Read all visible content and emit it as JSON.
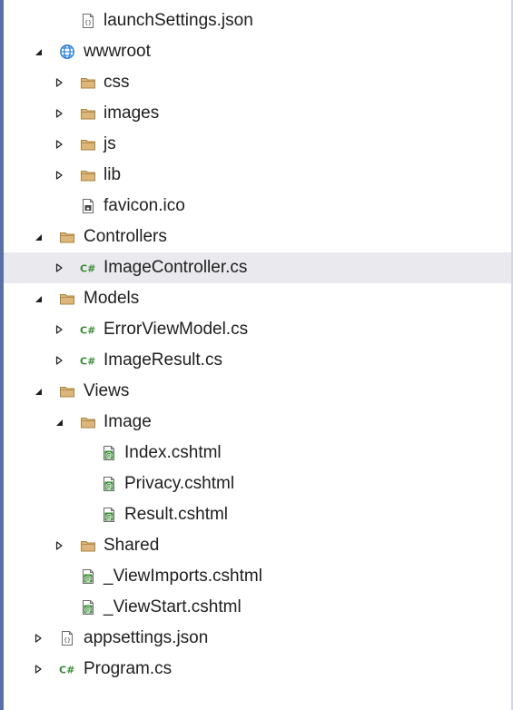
{
  "tree": [
    {
      "id": "launchsettings",
      "label": "launchSettings.json",
      "level": 1,
      "icon": "json-file-icon",
      "expander": "none"
    },
    {
      "id": "wwwroot",
      "label": "wwwroot",
      "level": 0,
      "icon": "globe-icon",
      "expander": "expanded"
    },
    {
      "id": "css",
      "label": "css",
      "level": 1,
      "icon": "folder-icon",
      "expander": "collapsed"
    },
    {
      "id": "images",
      "label": "images",
      "level": 1,
      "icon": "folder-icon",
      "expander": "collapsed"
    },
    {
      "id": "js",
      "label": "js",
      "level": 1,
      "icon": "folder-icon",
      "expander": "collapsed"
    },
    {
      "id": "lib",
      "label": "lib",
      "level": 1,
      "icon": "folder-icon",
      "expander": "collapsed"
    },
    {
      "id": "favicon",
      "label": "favicon.ico",
      "level": 1,
      "icon": "image-file-icon",
      "expander": "none"
    },
    {
      "id": "controllers",
      "label": "Controllers",
      "level": 0,
      "icon": "folder-icon",
      "expander": "expanded"
    },
    {
      "id": "imagecontroller",
      "label": "ImageController.cs",
      "level": 1,
      "icon": "csharp-file-icon",
      "expander": "collapsed",
      "selected": true
    },
    {
      "id": "models",
      "label": "Models",
      "level": 0,
      "icon": "folder-icon",
      "expander": "expanded"
    },
    {
      "id": "errorviewmodel",
      "label": "ErrorViewModel.cs",
      "level": 1,
      "icon": "csharp-file-icon",
      "expander": "collapsed"
    },
    {
      "id": "imageresult",
      "label": "ImageResult.cs",
      "level": 1,
      "icon": "csharp-file-icon",
      "expander": "collapsed"
    },
    {
      "id": "views",
      "label": "Views",
      "level": 0,
      "icon": "folder-icon",
      "expander": "expanded"
    },
    {
      "id": "image",
      "label": "Image",
      "level": 1,
      "icon": "folder-icon",
      "expander": "expanded"
    },
    {
      "id": "index",
      "label": "Index.cshtml",
      "level": 2,
      "icon": "razor-file-icon",
      "expander": "none"
    },
    {
      "id": "privacy",
      "label": "Privacy.cshtml",
      "level": 2,
      "icon": "razor-file-icon",
      "expander": "none"
    },
    {
      "id": "result",
      "label": "Result.cshtml",
      "level": 2,
      "icon": "razor-file-icon",
      "expander": "none"
    },
    {
      "id": "shared",
      "label": "Shared",
      "level": 1,
      "icon": "folder-icon",
      "expander": "collapsed"
    },
    {
      "id": "viewimports",
      "label": "_ViewImports.cshtml",
      "level": 1,
      "icon": "razor-file-icon",
      "expander": "none"
    },
    {
      "id": "viewstart",
      "label": "_ViewStart.cshtml",
      "level": 1,
      "icon": "razor-file-icon",
      "expander": "none"
    },
    {
      "id": "appsettings",
      "label": "appsettings.json",
      "level": 0,
      "icon": "json-file-icon",
      "expander": "collapsed"
    },
    {
      "id": "program",
      "label": "Program.cs",
      "level": 0,
      "icon": "csharp-file-icon",
      "expander": "collapsed"
    }
  ],
  "colors": {
    "folder": "#dcb67a",
    "folder_stroke": "#a9843f",
    "csharp": "#388a34",
    "razor": "#388a34",
    "globe": "#1e78d6",
    "selection": "#e9e9ee",
    "text": "#1e1e1e"
  }
}
